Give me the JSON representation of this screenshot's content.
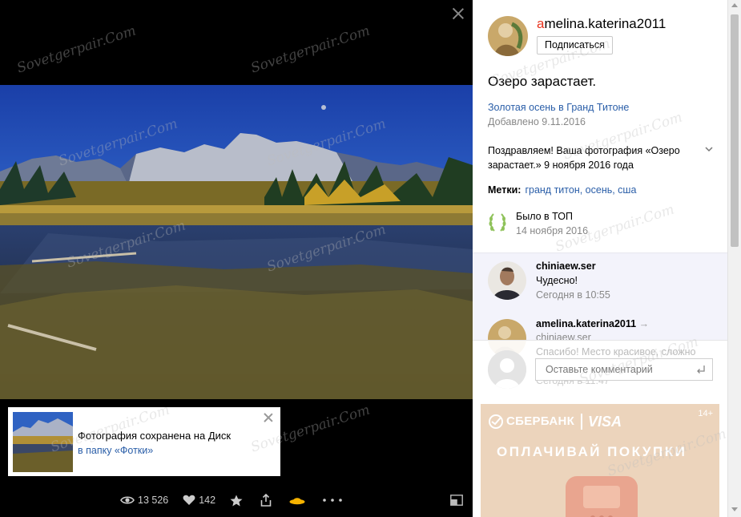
{
  "viewer": {
    "toast": {
      "title": "Фотография сохранена на Диск",
      "link": "в папку «Фотки»"
    },
    "toolbar": {
      "views": "13 526",
      "likes": "142"
    }
  },
  "panel": {
    "author": {
      "name_first": "a",
      "name_rest": "melina.katerina2011",
      "subscribe": "Подписаться"
    },
    "photo_title": "Озеро зарастает.",
    "album": "Золотая осень в Гранд Титоне",
    "added": "Добавлено 9.11.2016",
    "congrats": "Поздравляем! Ваша фотография «Озеро зарастает.» 9 ноября 2016 года",
    "tags": {
      "label": "Метки:",
      "value": "гранд титон, осень, сша"
    },
    "top": {
      "label": "Было в ТОП",
      "date": "14 ноября 2016"
    },
    "comments": [
      {
        "author": "chiniaew.ser",
        "text": "Чудесно!",
        "time": "Сегодня в 10:55"
      },
      {
        "author": "amelina.katerina2011",
        "reply_arrow": "→",
        "reply_to": "chiniaew.ser",
        "text": "Спасибо! Место красивое, сложно",
        "time": "Сегодня в 11:47"
      }
    ],
    "comment_input": {
      "placeholder": "Оставьте комментарий"
    },
    "ad": {
      "bank": "СБЕРБАНК",
      "visa": "VISA",
      "age": "14+",
      "slogan": "ОПЛАЧИВАЙ ПОКУПКИ"
    }
  },
  "watermark": "Sovetgerpair.Com",
  "colors": {
    "link": "#2a5ea8",
    "author_initial": "#e8341f",
    "comments_bg": "#f3f3fb",
    "ad_bg": "#ecd4bc"
  }
}
